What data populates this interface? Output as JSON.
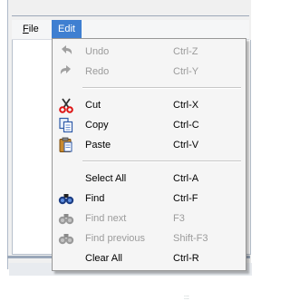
{
  "menubar": {
    "file_label": "File",
    "file_mnemonic": "F",
    "file_rest": "ile",
    "edit_label": "Edit"
  },
  "edit_menu": {
    "items": [
      {
        "label": "Undo",
        "shortcut": "Ctrl-Z",
        "enabled": false,
        "icon": "undo-icon"
      },
      {
        "label": "Redo",
        "shortcut": "Ctrl-Y",
        "enabled": false,
        "icon": "redo-icon"
      },
      {
        "label": "Cut",
        "shortcut": "Ctrl-X",
        "enabled": true,
        "icon": "scissors-icon"
      },
      {
        "label": "Copy",
        "shortcut": "Ctrl-C",
        "enabled": true,
        "icon": "copy-icon"
      },
      {
        "label": "Paste",
        "shortcut": "Ctrl-V",
        "enabled": true,
        "icon": "paste-icon"
      },
      {
        "label": "Select All",
        "shortcut": "Ctrl-A",
        "enabled": true,
        "icon": ""
      },
      {
        "label": "Find",
        "shortcut": "Ctrl-F",
        "enabled": true,
        "icon": "binoculars-icon"
      },
      {
        "label": "Find next",
        "shortcut": "F3",
        "enabled": false,
        "icon": "binoculars-icon"
      },
      {
        "label": "Find previous",
        "shortcut": "Shift-F3",
        "enabled": false,
        "icon": "binoculars-icon"
      },
      {
        "label": "Clear All",
        "shortcut": "Ctrl-R",
        "enabled": true,
        "icon": ""
      }
    ]
  },
  "colors": {
    "menu_highlight": "#3f7fd1",
    "disabled_text": "#9b9b9b"
  }
}
